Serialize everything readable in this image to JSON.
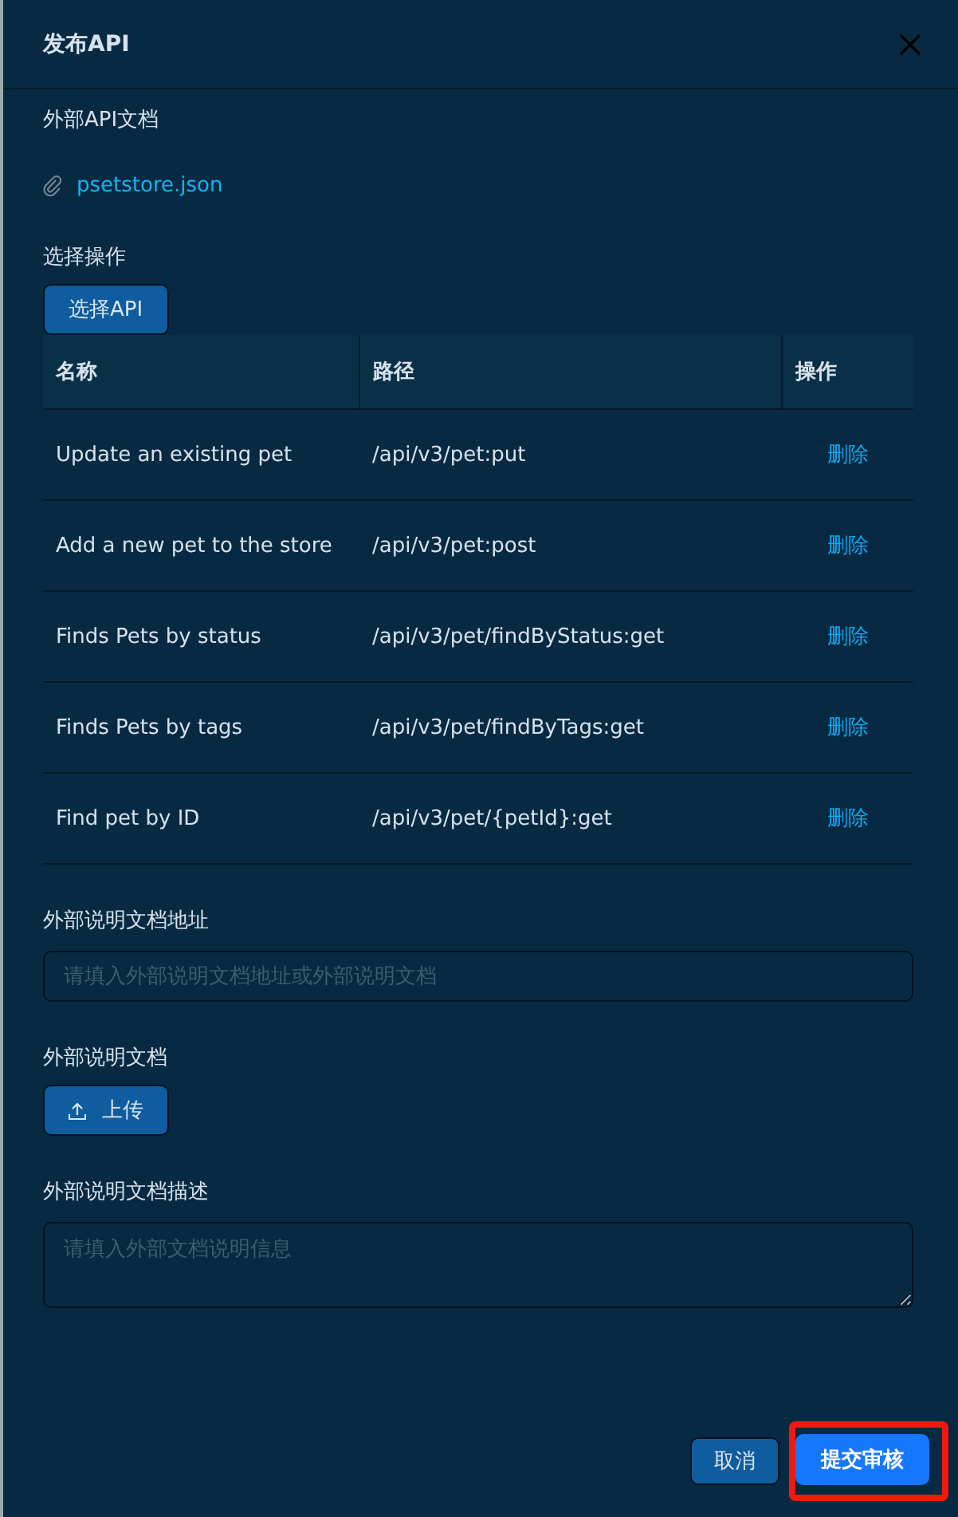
{
  "dialog": {
    "title": "发布API"
  },
  "doc_section": {
    "label": "外部API文档",
    "file": "psetstore.json"
  },
  "operation_section": {
    "label": "选择操作",
    "button": "选择API"
  },
  "table": {
    "columns": [
      "名称",
      "路径",
      "操作"
    ],
    "rows": [
      {
        "name": "Update an existing pet",
        "path": "/api/v3/pet:put",
        "action": "删除"
      },
      {
        "name": "Add a new pet to the store",
        "path": "/api/v3/pet:post",
        "action": "删除"
      },
      {
        "name": "Finds Pets by status",
        "path": "/api/v3/pet/findByStatus:get",
        "action": "删除"
      },
      {
        "name": "Finds Pets by tags",
        "path": "/api/v3/pet/findByTags:get",
        "action": "删除"
      },
      {
        "name": "Find pet by ID",
        "path": "/api/v3/pet/{petId}:get",
        "action": "删除"
      }
    ]
  },
  "url_field": {
    "label": "外部说明文档地址",
    "placeholder": "请填入外部说明文档地址或外部说明文档"
  },
  "upload_section": {
    "label": "外部说明文档",
    "button": "上传"
  },
  "desc_field": {
    "label": "外部说明文档描述",
    "placeholder": "请填入外部文档说明信息"
  },
  "footer": {
    "cancel": "取消",
    "submit": "提交审核",
    "submit_highlighted": true
  }
}
